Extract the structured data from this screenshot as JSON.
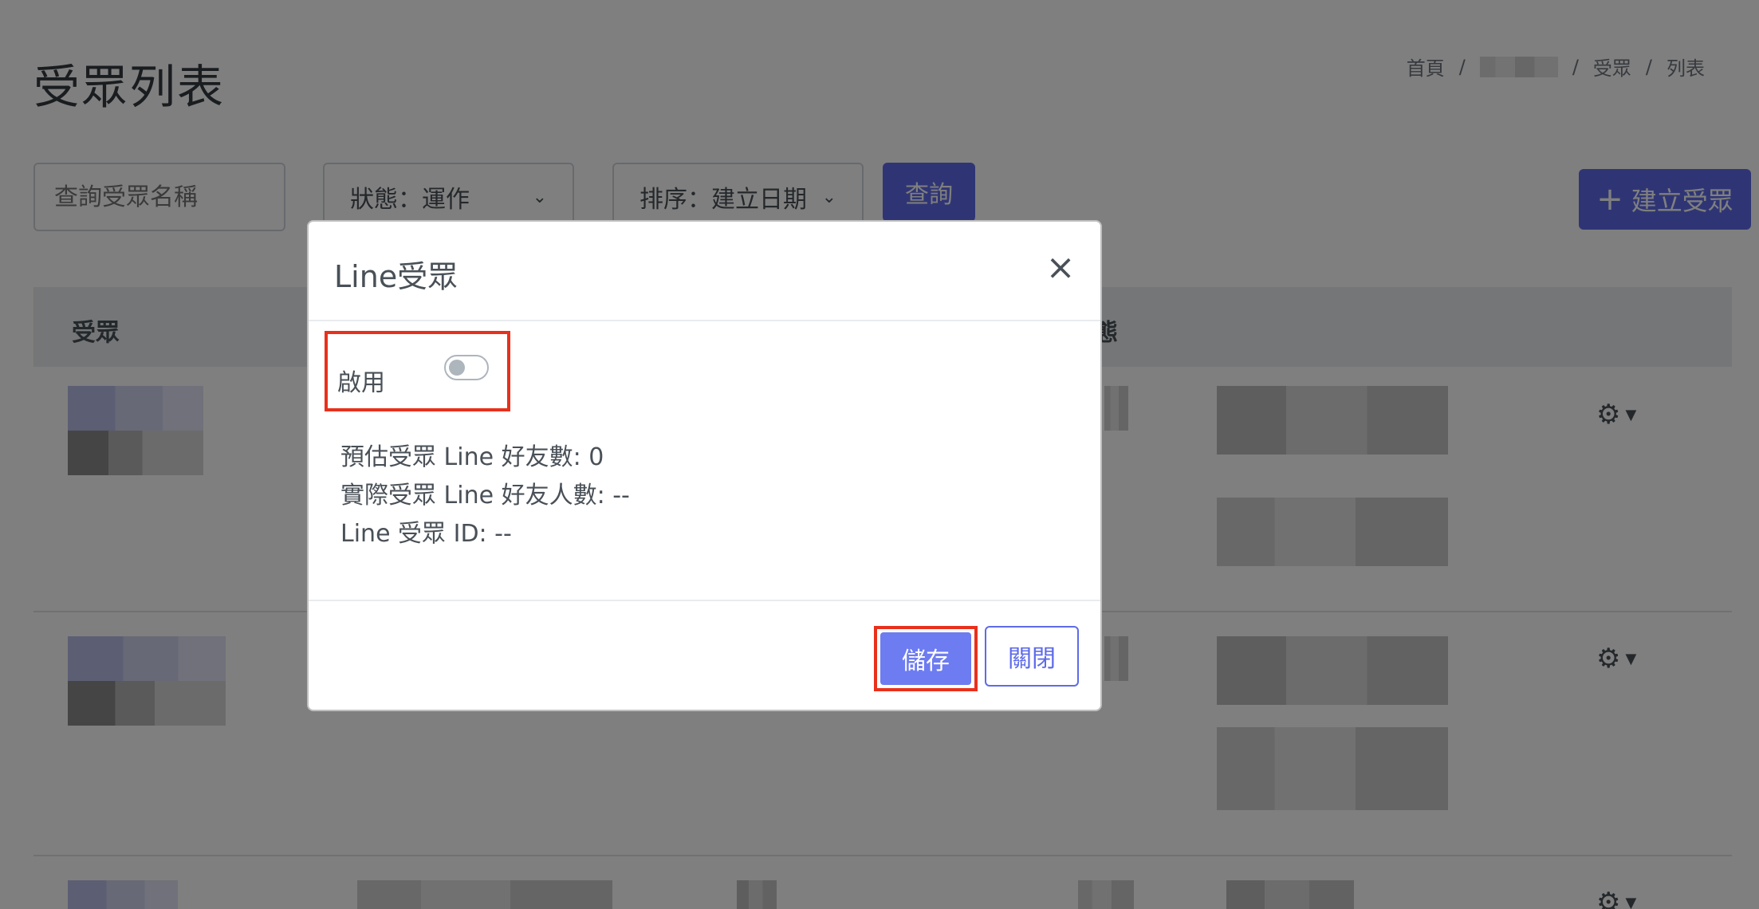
{
  "page": {
    "title": "受眾列表",
    "breadcrumb": [
      "首頁",
      "受眾",
      "列表"
    ]
  },
  "filters": {
    "search_placeholder": "查詢受眾名稱",
    "status_select": "狀態：運作",
    "sort_select": "排序：建立日期",
    "query_button": "查詢",
    "create_button": "建立受眾"
  },
  "table": {
    "headers": [
      "受眾",
      "態"
    ]
  },
  "modal": {
    "title": "Line受眾",
    "close_symbol": "×",
    "enable_label": "啟用",
    "enabled": false,
    "estimated_friends": "預估受眾 Line 好友數: 0",
    "actual_friends": "實際受眾 Line 好友人數: --",
    "audience_id": "Line 受眾 ID: --",
    "save_button": "儲存",
    "close_button": "關閉"
  },
  "colors": {
    "primary": "#5e6be8",
    "highlight": "#e8301c"
  }
}
